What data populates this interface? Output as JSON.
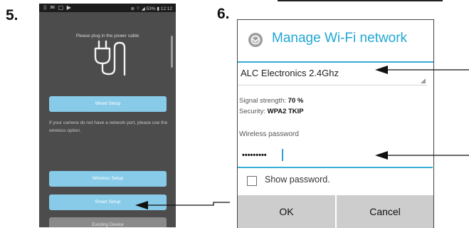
{
  "steps": {
    "step5": "5.",
    "step6": "6."
  },
  "phone1": {
    "status_left": "⌷ ✉ ▢ ▶",
    "status_right": "⊕ ⌔ ◢ 53% ▮ 12:12",
    "plug_text": "Please plug in the power cable",
    "wired_button": "Wired Setup",
    "info_text": "If your camera do not have a network port, please use the wireless option.",
    "wireless_button": "Wireless Setup",
    "smart_button": "Smart Setup",
    "existing_button": "Existing Device"
  },
  "dialog": {
    "title": "Manage Wi-Fi network",
    "ssid": "ALC Electronics 2.4Ghz",
    "signal_label": "Signal strength:",
    "signal_value": "70 %",
    "security_label": "Security:",
    "security_value": "WPA2 TKIP",
    "password_label": "Wireless password",
    "password_value": "•••••••••",
    "show_password": "Show password.",
    "ok": "OK",
    "cancel": "Cancel"
  },
  "colors": {
    "accent": "#21a7d5",
    "phone_button": "#87cbe9",
    "phone_bg": "#4c4c4c"
  }
}
